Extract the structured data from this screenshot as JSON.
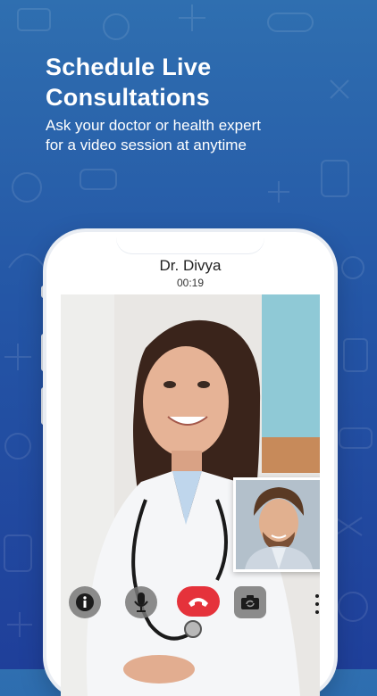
{
  "promo": {
    "headline_line1": "Schedule Live",
    "headline_line2": "Consultations",
    "subline_line1": "Ask your doctor or health expert",
    "subline_line2": "for a video session at anytime"
  },
  "call": {
    "doctor_name": "Dr. Divya",
    "elapsed": "00:19"
  },
  "controls": [
    {
      "name": "info-icon"
    },
    {
      "name": "microphone-icon"
    },
    {
      "name": "end-call-icon"
    },
    {
      "name": "switch-camera-icon"
    },
    {
      "name": "more-options-icon"
    }
  ],
  "colors": {
    "background_top": "#2f6fb0",
    "background_bottom": "#1f3f9a",
    "end_call": "#e5323b",
    "control_gray": "#787878"
  }
}
